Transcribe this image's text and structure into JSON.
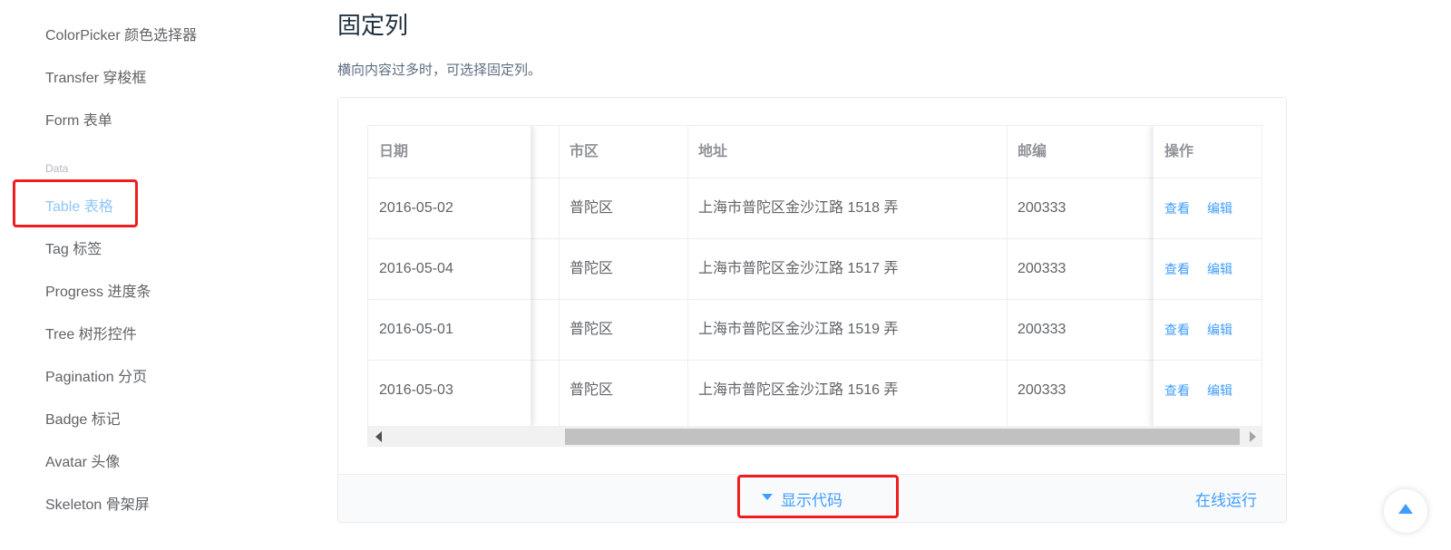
{
  "sidebar": {
    "items": [
      {
        "label": "ColorPicker 颜色选择器"
      },
      {
        "label": "Transfer 穿梭框"
      },
      {
        "label": "Form 表单"
      },
      {
        "label": "Table 表格"
      },
      {
        "label": "Tag 标签"
      },
      {
        "label": "Progress 进度条"
      },
      {
        "label": "Tree 树形控件"
      },
      {
        "label": "Pagination 分页"
      },
      {
        "label": "Badge 标记"
      },
      {
        "label": "Avatar 头像"
      },
      {
        "label": "Skeleton 骨架屏"
      }
    ],
    "group_label": "Data",
    "active_item": "Table 表格"
  },
  "main": {
    "title": "固定列",
    "description": "横向内容过多时，可选择固定列。"
  },
  "table": {
    "headers": {
      "date": "日期",
      "district": "市区",
      "address": "地址",
      "zip": "邮编",
      "ops": "操作"
    },
    "rows": [
      {
        "date": "2016-05-02",
        "district": "普陀区",
        "address": "上海市普陀区金沙江路 1518 弄",
        "zip": "200333"
      },
      {
        "date": "2016-05-04",
        "district": "普陀区",
        "address": "上海市普陀区金沙江路 1517 弄",
        "zip": "200333"
      },
      {
        "date": "2016-05-01",
        "district": "普陀区",
        "address": "上海市普陀区金沙江路 1519 弄",
        "zip": "200333"
      },
      {
        "date": "2016-05-03",
        "district": "普陀区",
        "address": "上海市普陀区金沙江路 1516 弄",
        "zip": "200333"
      }
    ],
    "view_label": "查看",
    "edit_label": "编辑"
  },
  "footer": {
    "show_code_label": "显示代码",
    "run_online_label": "在线运行"
  },
  "colors": {
    "accent": "#409eff",
    "active_nav": "#8ec5fb",
    "highlight_box": "#ef1d1d"
  },
  "icons": {
    "caret": "caret-down-icon",
    "back_to_top": "arrow-up-icon",
    "scroll_left": "arrow-left-icon",
    "scroll_right": "arrow-right-icon"
  }
}
